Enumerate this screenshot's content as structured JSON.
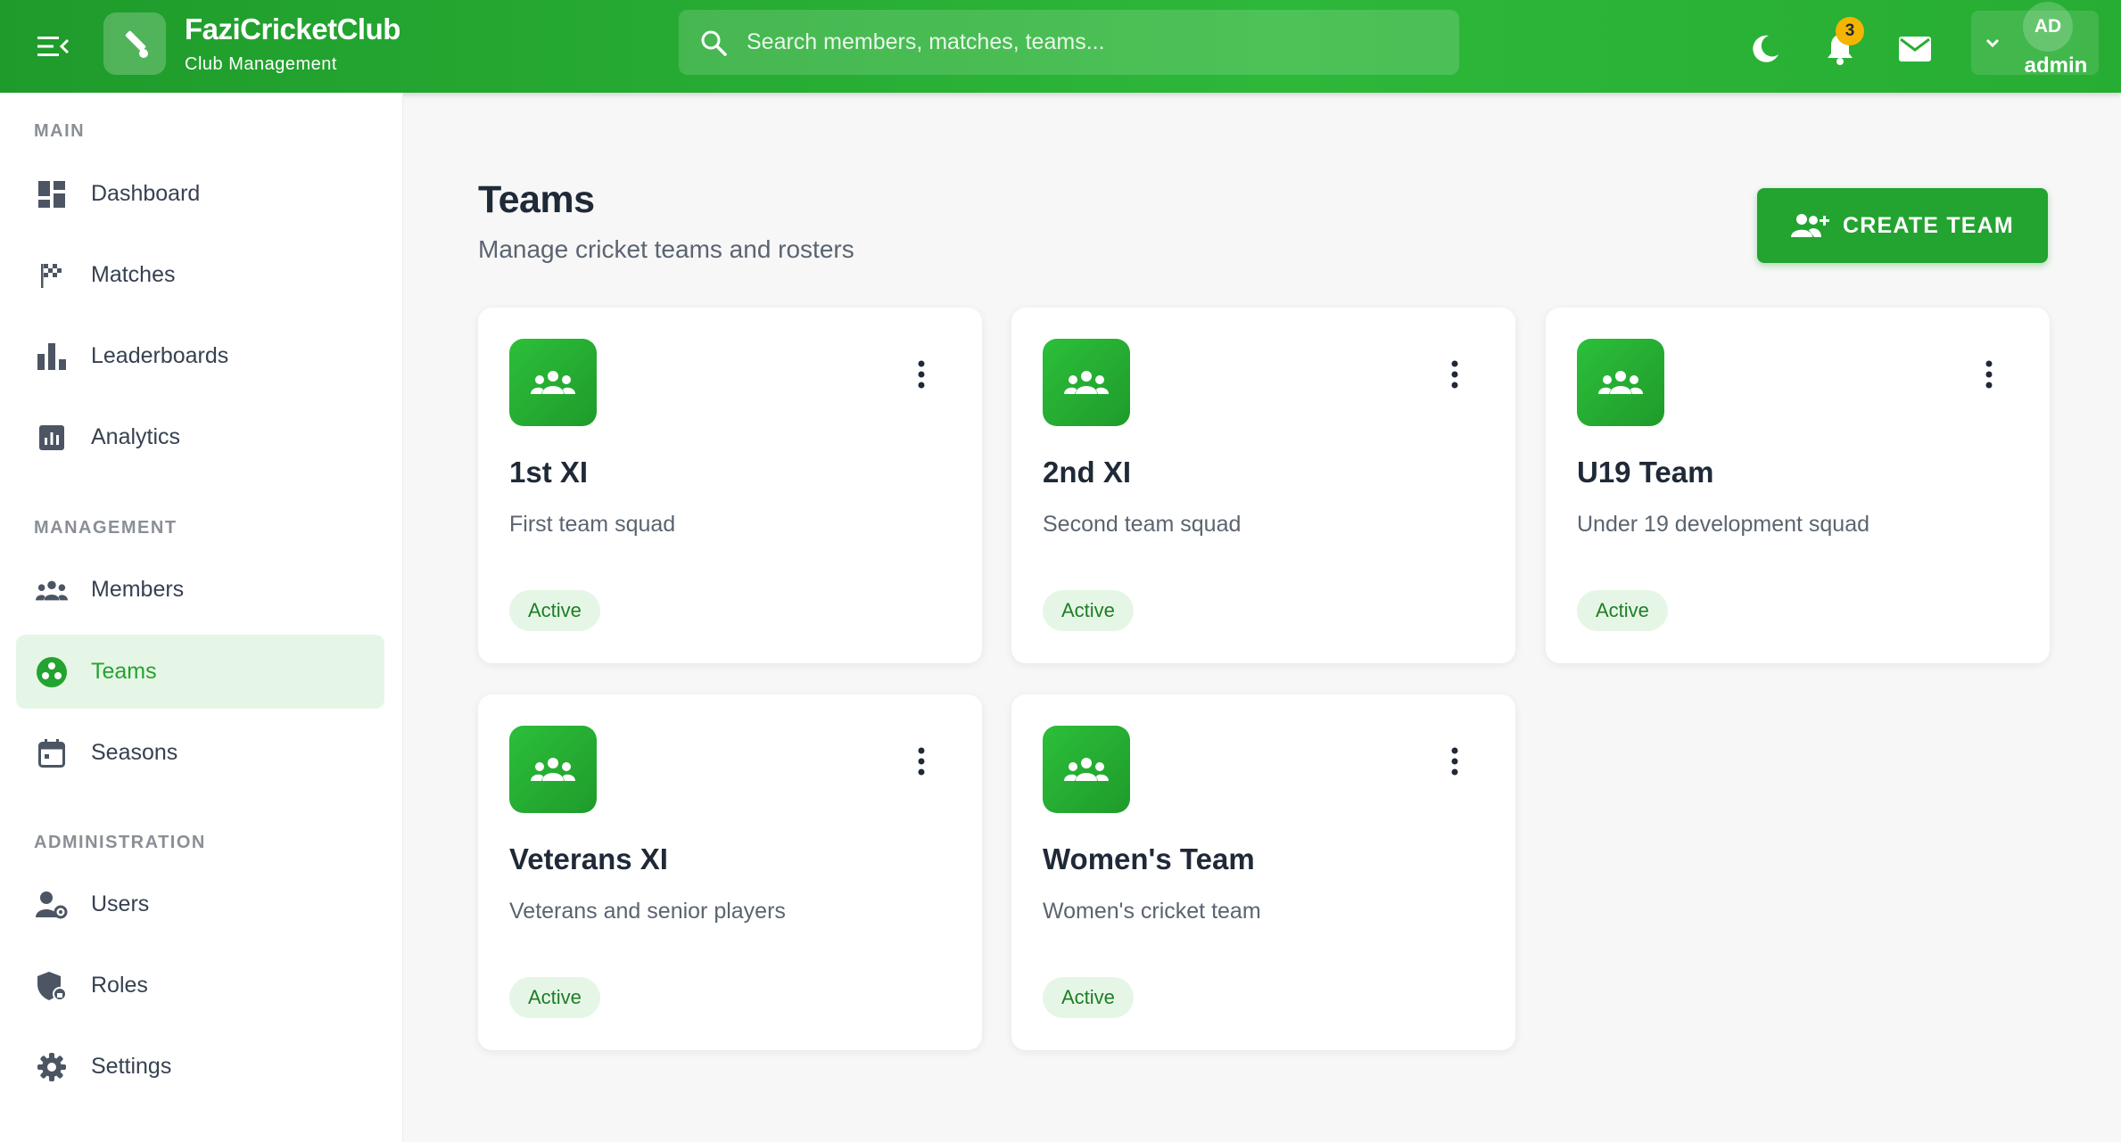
{
  "brand": {
    "name": "FaziCricketClub",
    "subtitle": "Club Management"
  },
  "search": {
    "placeholder": "Search members, matches, teams..."
  },
  "notifications": {
    "count": "3"
  },
  "user": {
    "initials": "AD",
    "name": "admin"
  },
  "sidebar": {
    "sections": [
      {
        "label": "MAIN",
        "items": [
          {
            "label": "Dashboard",
            "icon": "dashboard-icon"
          },
          {
            "label": "Matches",
            "icon": "checkered-flag-icon"
          },
          {
            "label": "Leaderboards",
            "icon": "bar-chart-icon"
          },
          {
            "label": "Analytics",
            "icon": "analytics-icon"
          }
        ]
      },
      {
        "label": "MANAGEMENT",
        "items": [
          {
            "label": "Members",
            "icon": "group-icon"
          },
          {
            "label": "Teams",
            "icon": "teams-icon",
            "active": true
          },
          {
            "label": "Seasons",
            "icon": "calendar-icon"
          }
        ]
      },
      {
        "label": "ADMINISTRATION",
        "items": [
          {
            "label": "Users",
            "icon": "user-settings-icon"
          },
          {
            "label": "Roles",
            "icon": "shield-icon"
          },
          {
            "label": "Settings",
            "icon": "gear-icon"
          }
        ]
      }
    ]
  },
  "page": {
    "title": "Teams",
    "subtitle": "Manage cricket teams and rosters",
    "create_label": "CREATE TEAM"
  },
  "teams": [
    {
      "name": "1st XI",
      "description": "First team squad",
      "status": "Active"
    },
    {
      "name": "2nd XI",
      "description": "Second team squad",
      "status": "Active"
    },
    {
      "name": "U19 Team",
      "description": "Under 19 development squad",
      "status": "Active"
    },
    {
      "name": "Veterans XI",
      "description": "Veterans and senior players",
      "status": "Active"
    },
    {
      "name": "Women's Team",
      "description": "Women's cricket team",
      "status": "Active"
    }
  ],
  "colors": {
    "primary": "#23a330",
    "active_bg": "#e6f6e6",
    "badge": "#f5b400"
  }
}
